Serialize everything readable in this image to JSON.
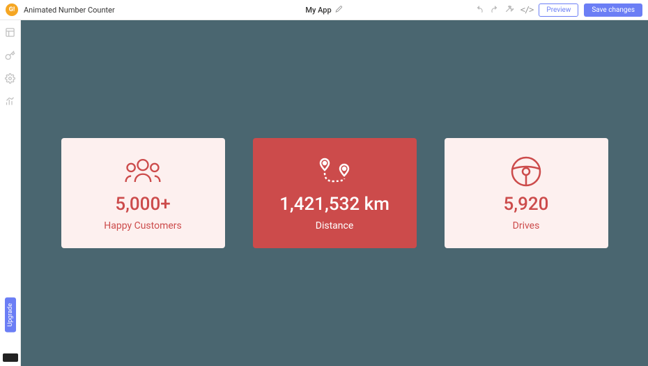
{
  "header": {
    "appTitle": "Animated Number Counter",
    "centerTitle": "My App",
    "previewLabel": "Preview",
    "saveLabel": "Save changes"
  },
  "sidebar": {
    "upgradeLabel": "Upgrade"
  },
  "counters": [
    {
      "value": "5,000+",
      "label": "Happy Customers",
      "icon": "people-icon",
      "variant": "light"
    },
    {
      "value": "1,421,532 km",
      "label": "Distance",
      "icon": "route-icon",
      "variant": "dark"
    },
    {
      "value": "5,920",
      "label": "Drives",
      "icon": "steering-wheel-icon",
      "variant": "light"
    }
  ],
  "colors": {
    "canvasBg": "#4a6670",
    "accentRed": "#cc4b4b",
    "lightCardBg": "#fdf0ef",
    "primaryBlue": "#6b7ef5"
  }
}
